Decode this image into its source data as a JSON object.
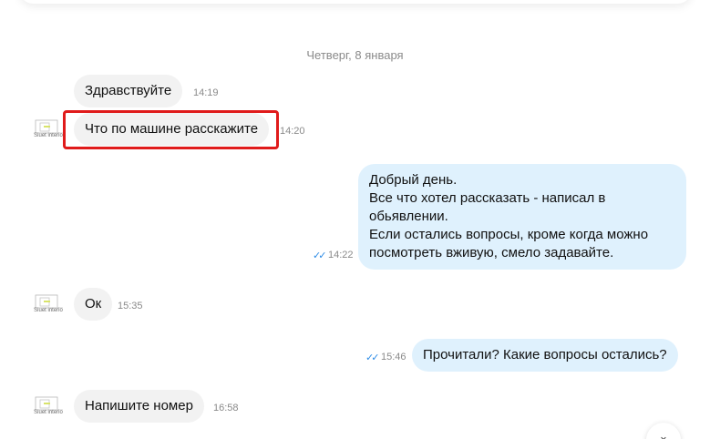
{
  "date_separator": "Четверг, 8 января",
  "avatar_label": "Siuet interio",
  "messages": [
    {
      "direction": "in",
      "text": "Здравствуйте",
      "time": "14:19",
      "show_avatar": false,
      "highlighted": false
    },
    {
      "direction": "in",
      "text": "Что по машине расскажите",
      "time": "14:20",
      "show_avatar": true,
      "highlighted": true
    },
    {
      "direction": "out",
      "lines": [
        "Добрый день.",
        "Все что хотел рассказать - написал в",
        "обьявлении.",
        "Если остались вопросы, кроме когда можно",
        "посмотреть вживую, смело задавайте."
      ],
      "time": "14:22",
      "read": true
    },
    {
      "direction": "in",
      "text": "Ок",
      "time": "15:35",
      "show_avatar": true,
      "highlighted": false
    },
    {
      "direction": "out",
      "text": "Прочитали? Какие вопросы остались?",
      "time": "15:46",
      "read": true
    },
    {
      "direction": "in",
      "text": "Напишите номер",
      "time": "16:58",
      "show_avatar": true,
      "highlighted": false
    }
  ],
  "icons": {
    "read_receipt": "double-check-icon",
    "scroll_down": "chevron-down-icon"
  },
  "colors": {
    "incoming_bubble": "#f2f2f2",
    "outgoing_bubble": "#dff1fd",
    "read_check": "#2d8ce6",
    "highlight": "#e01b1b"
  }
}
